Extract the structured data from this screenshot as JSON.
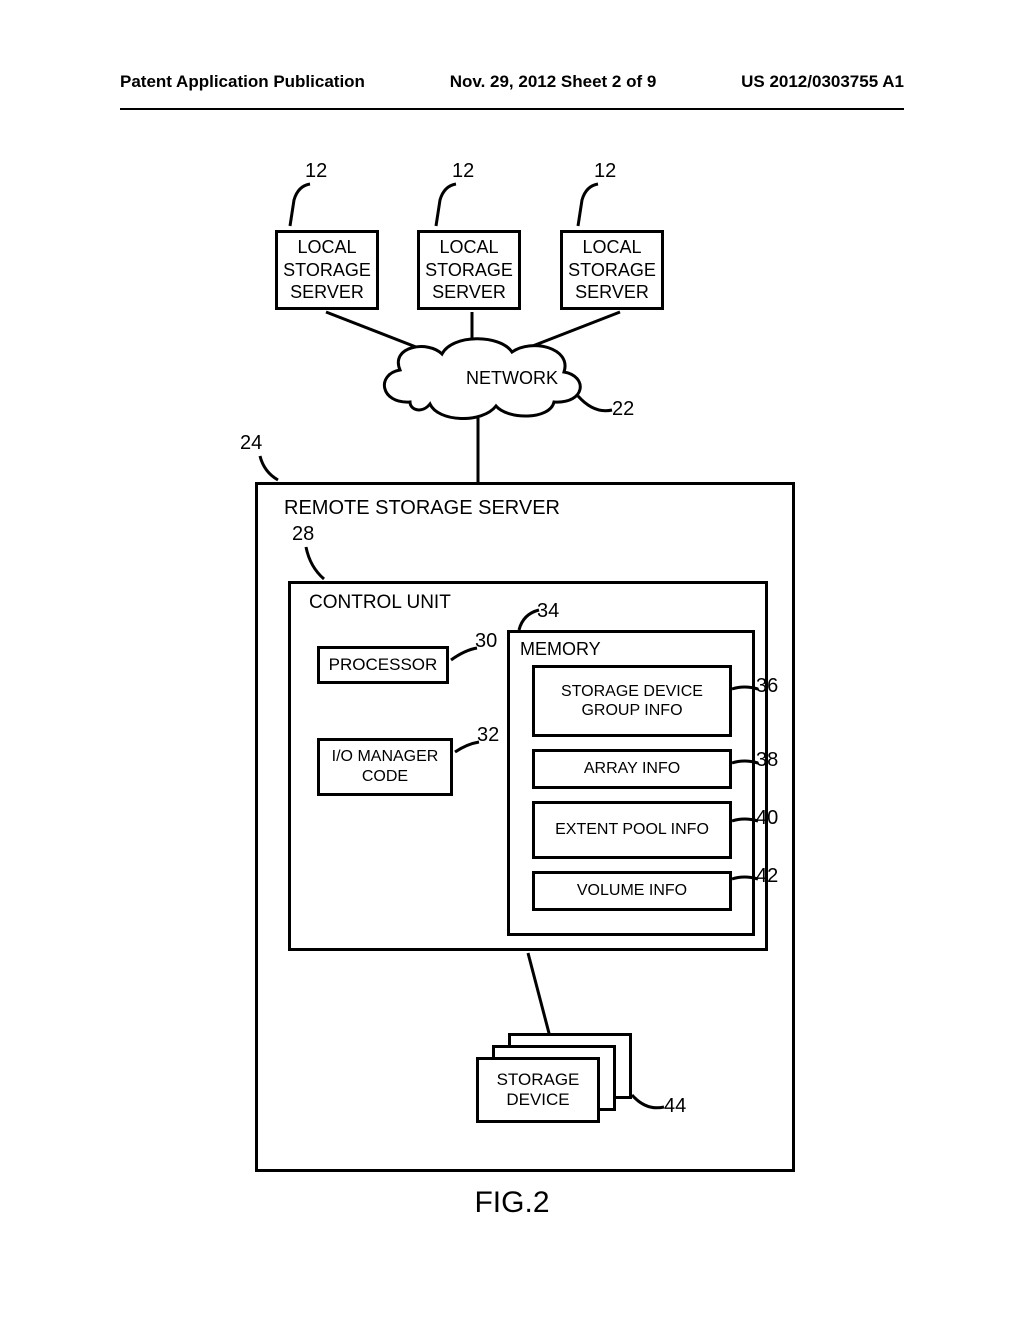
{
  "header": {
    "left": "Patent Application Publication",
    "center": "Nov. 29, 2012  Sheet 2 of 9",
    "right": "US 2012/0303755 A1"
  },
  "refs": {
    "r12": "12",
    "r22": "22",
    "r24": "24",
    "r28": "28",
    "r30": "30",
    "r32": "32",
    "r34": "34",
    "r36": "36",
    "r38": "38",
    "r40": "40",
    "r42": "42",
    "r44": "44"
  },
  "labels": {
    "local_server": "LOCAL STORAGE SERVER",
    "network": "NETWORK",
    "remote_server": "REMOTE STORAGE SERVER",
    "control_unit": "CONTROL UNIT",
    "processor": "PROCESSOR",
    "io_manager": "I/O MANAGER CODE",
    "memory": "MEMORY",
    "storage_device_group": "STORAGE DEVICE GROUP INFO",
    "array_info": "ARRAY INFO",
    "extent_pool": "EXTENT POOL INFO",
    "volume_info": "VOLUME INFO",
    "storage_device": "STORAGE DEVICE",
    "figure": "FIG.2"
  }
}
